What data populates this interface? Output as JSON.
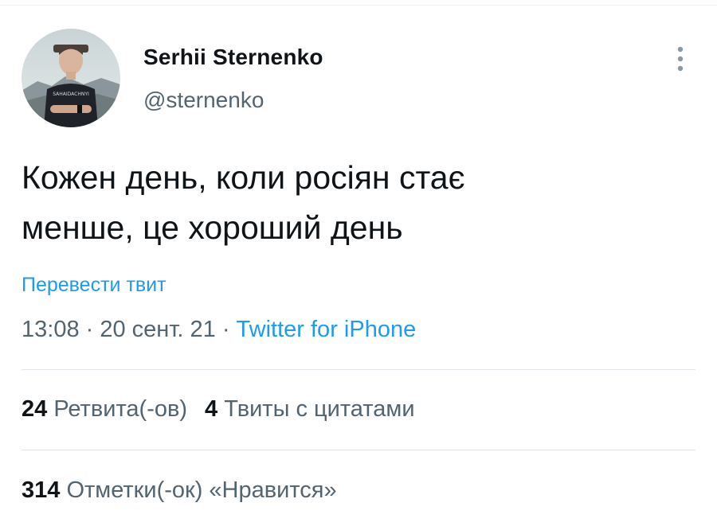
{
  "author": {
    "display_name": "Serhii Sternenko",
    "handle": "@sternenko",
    "avatar_icon": "profile-photo"
  },
  "tweet": {
    "text_line1": "Кожен день, коли росіян стає",
    "text_line2": "менше, це хороший день",
    "translate_label": "Перевести твит"
  },
  "meta": {
    "time": "13:08",
    "separator": " · ",
    "date": "20 сент. 21",
    "source": "Twitter for iPhone"
  },
  "stats": {
    "retweets_count": "24",
    "retweets_label": "Ретвита(-ов)",
    "quotes_count": "4",
    "quotes_label": "Твиты с цитатами",
    "likes_count": "314",
    "likes_label": "Отметки(-ок) «Нравится»"
  },
  "colors": {
    "link": "#1d9bf0",
    "secondary_text": "#536471",
    "primary_text": "#0f1419"
  }
}
